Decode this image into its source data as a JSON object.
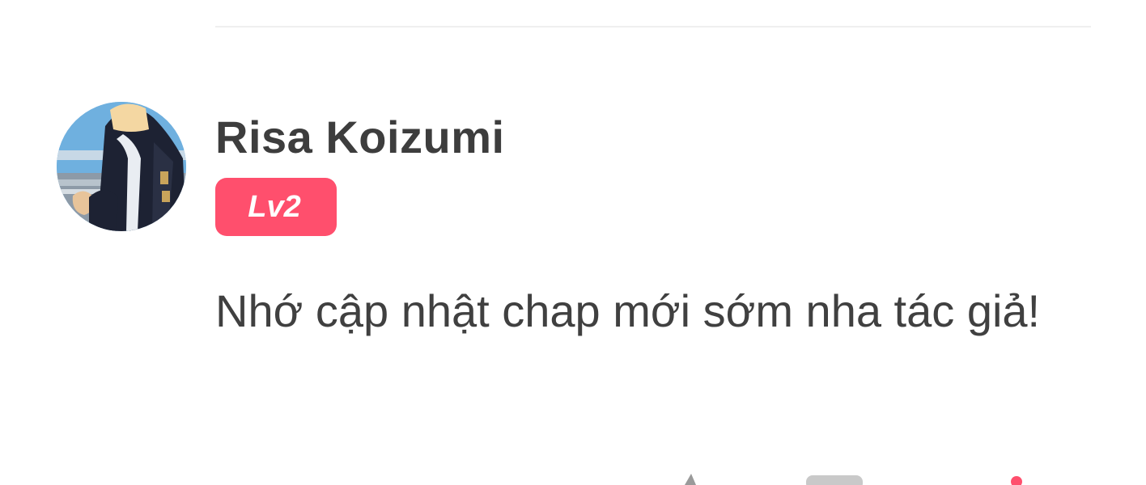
{
  "comment": {
    "username": "Risa Koizumi",
    "level": "Lv2",
    "text": "Nhớ cập nhật chap mới sớm nha tác giả!"
  },
  "colors": {
    "badge_bg": "#ff4f6d",
    "username": "#3d3d3d",
    "text": "#404040",
    "divider": "#efefef"
  },
  "icons": {
    "avatar": "user-avatar-anime",
    "like": "like-icon",
    "reply": "reply-icon",
    "more": "more-icon"
  }
}
